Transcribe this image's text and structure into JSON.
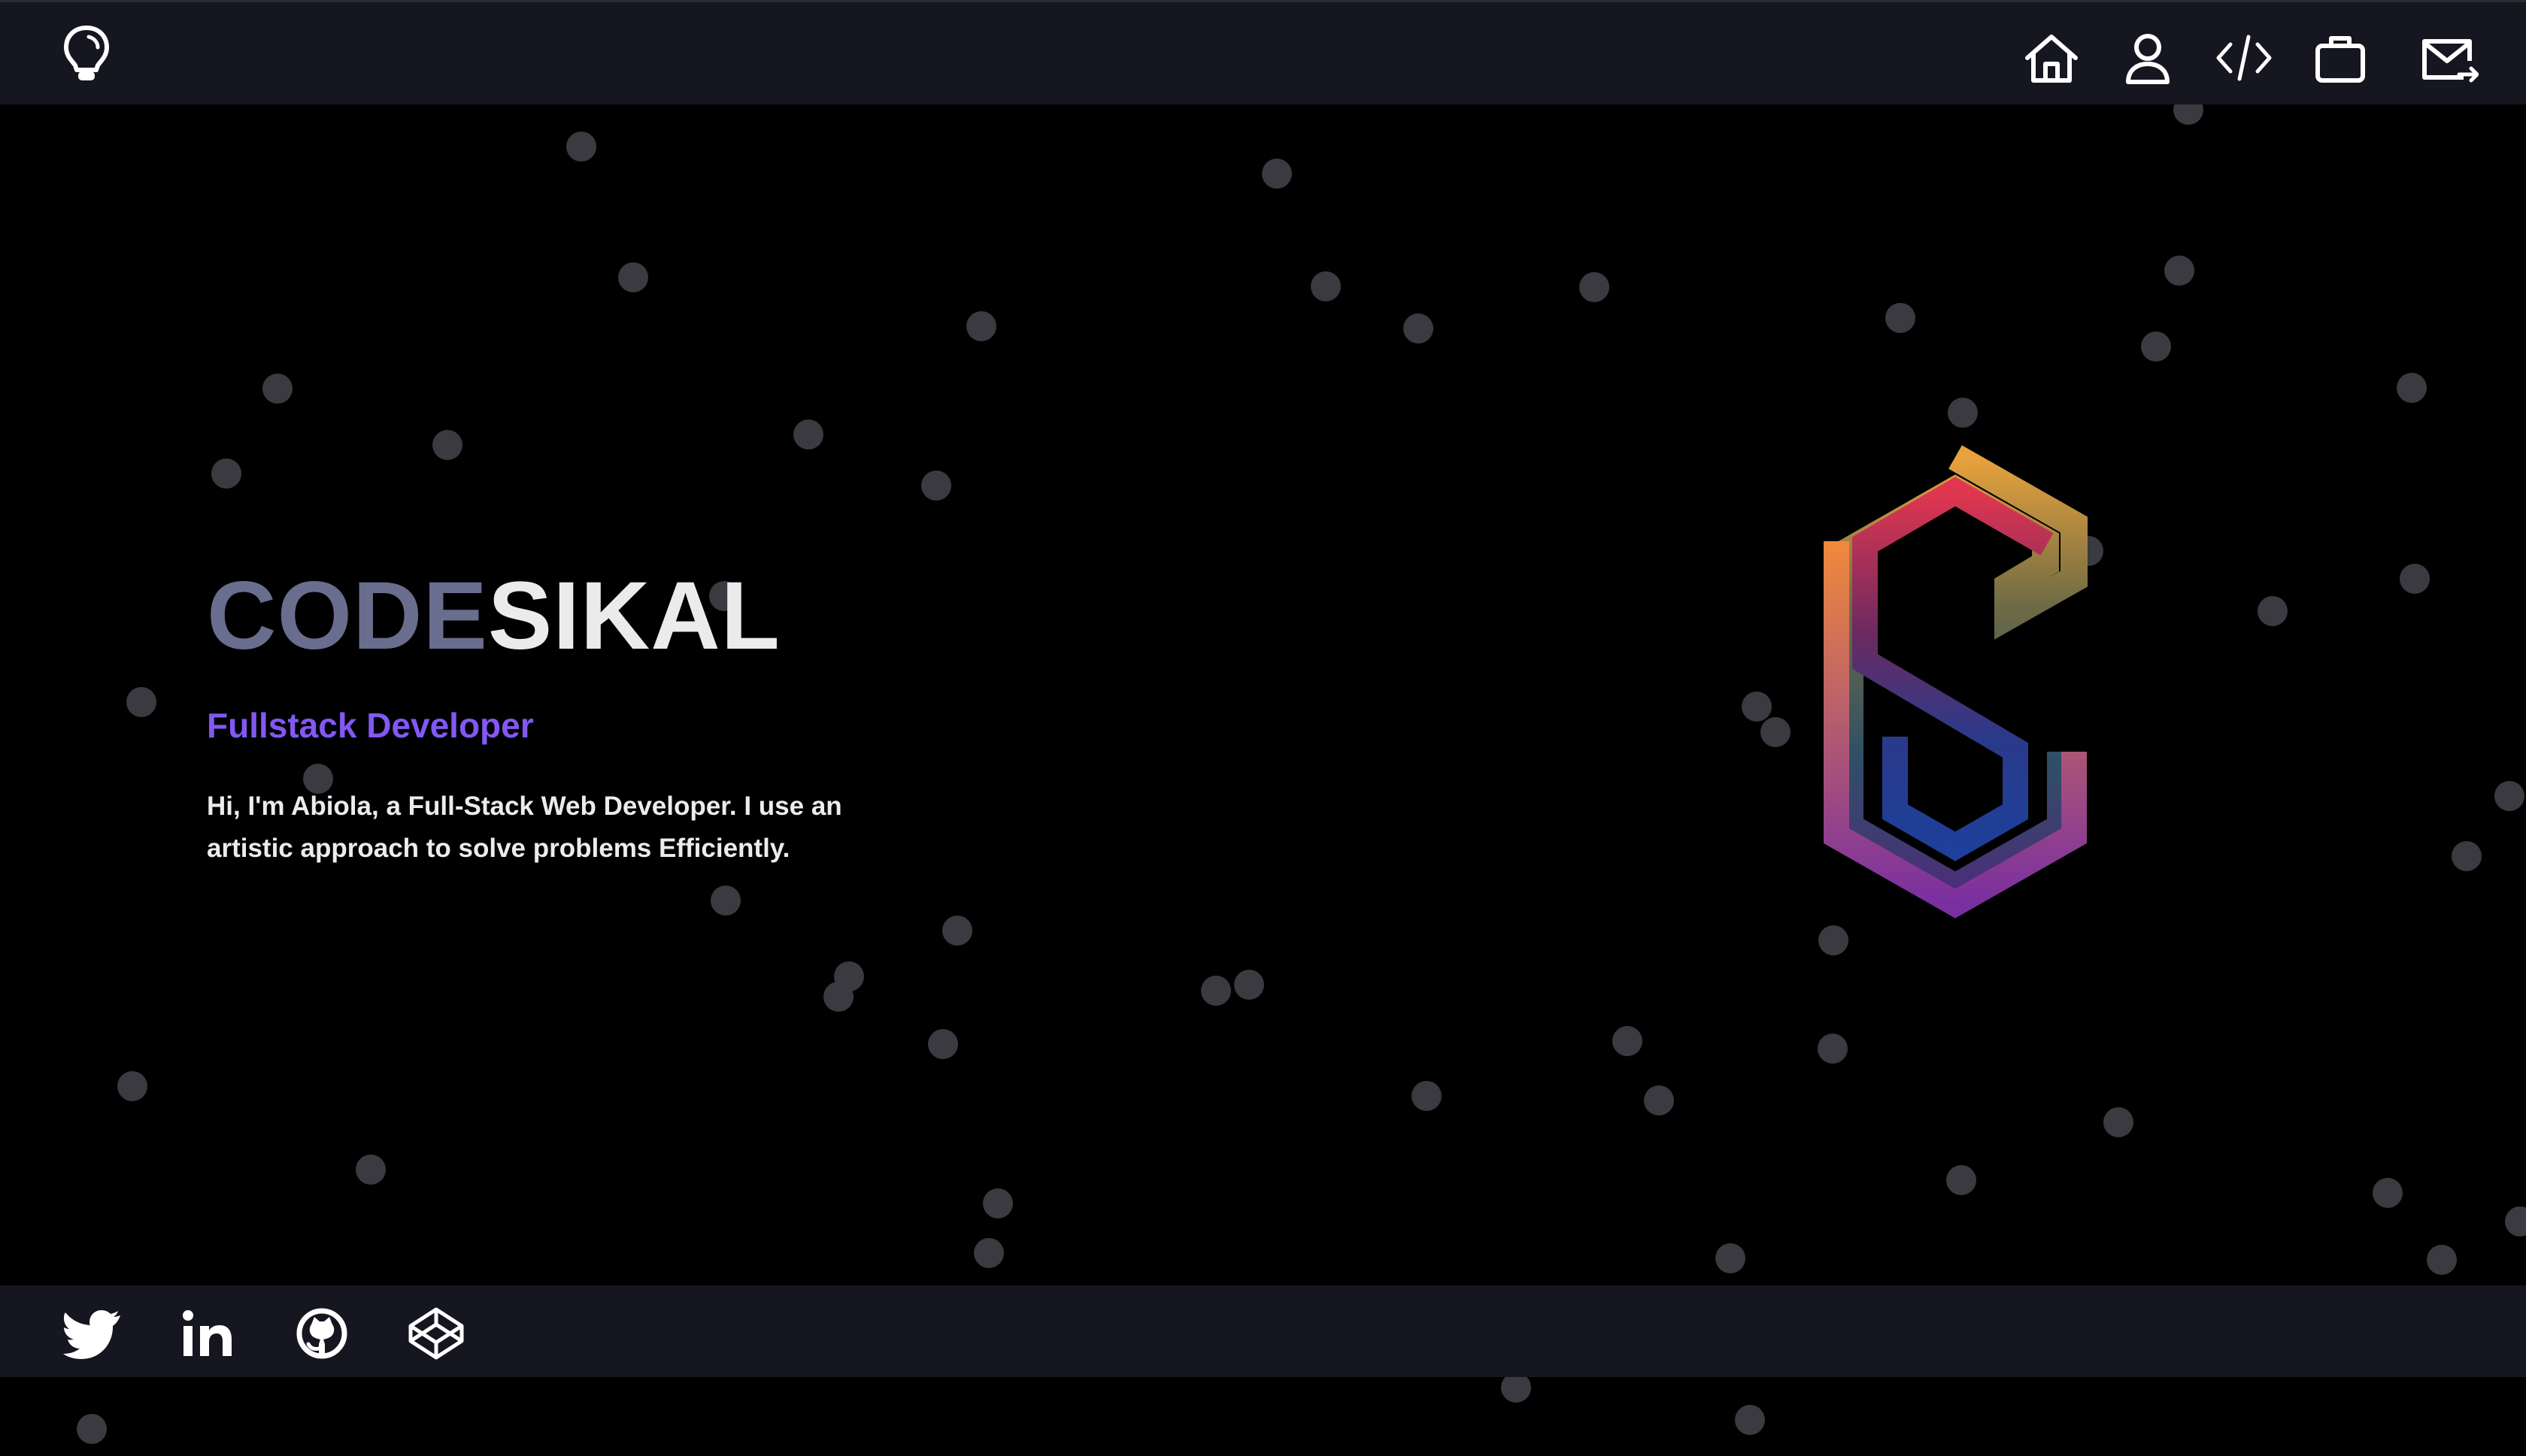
{
  "header": {
    "logo_icon": "lightbulb-icon",
    "nav": [
      {
        "icon": "home-icon",
        "label": "Home"
      },
      {
        "icon": "user-icon",
        "label": "About"
      },
      {
        "icon": "code-icon",
        "label": "Skills"
      },
      {
        "icon": "briefcase-icon",
        "label": "Work"
      },
      {
        "icon": "mail-icon",
        "label": "Contact"
      }
    ]
  },
  "hero": {
    "title_part1": "CODE",
    "title_part2": "SIKAL",
    "role": "Fullstack Developer",
    "intro": "Hi, I'm Abiola, a Full-Stack Web Developer. I use an artistic approach to solve problems Efficiently.",
    "brand_mark": "codesikal-s-logo"
  },
  "footer": {
    "social": [
      {
        "icon": "twitter-icon"
      },
      {
        "icon": "linkedin-icon"
      },
      {
        "icon": "github-icon"
      },
      {
        "icon": "codepen-icon"
      }
    ]
  },
  "colors": {
    "background": "#000000",
    "bar": "#151620",
    "title_muted": "#696d8e",
    "title_light": "#ebebeb",
    "accent": "#8258f3",
    "particle": "#3a3a40"
  }
}
